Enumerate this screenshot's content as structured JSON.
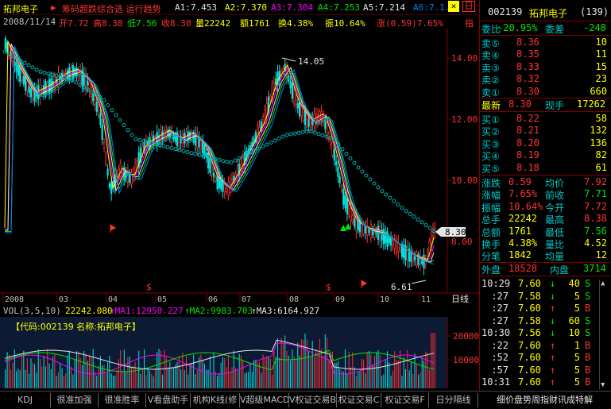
{
  "header": {
    "stock_name": "拓邦电子",
    "indicator_title": "筹码超跌综合选 运行趋势",
    "a1": "A1:7.453",
    "a2": "A2:7.370",
    "a3": "A3:7.304",
    "a4": "A4:7.253",
    "a5": "A5:7.214",
    "a6": "A6:7.1..",
    "window_close": "日"
  },
  "price_line": {
    "date": "2008/11/14",
    "open": "开7.72",
    "high": "高8.38",
    "low": "低7.56",
    "close": "收8.30",
    "volume": "量22242",
    "amount": "额1761",
    "turnover": "换4.38%",
    "amplitude": "振10.64%",
    "change": "涨(0.59)7.65%",
    "extra": "指"
  },
  "price_axis": [
    "14.00",
    "12.00",
    "10.00",
    "8.00"
  ],
  "annotations": {
    "high_label": "14.05",
    "low_label": "6.61",
    "current_tag": "8.30"
  },
  "date_axis": [
    "2008",
    "03",
    "04",
    "05",
    "06",
    "07",
    "08",
    "09",
    "10",
    "11"
  ],
  "date_axis_right": "日线",
  "volume_header": {
    "title": "VOL(3,5,10)",
    "vol": "22242.080",
    "ma1": "↑MA1:12950.227",
    "ma2": "↑MA2:9983.703",
    "ma3": "↑MA3:6164.927"
  },
  "volume_axis": [
    "20000",
    "10000"
  ],
  "volume_panel_label": "【代码:002139 名称:拓邦电子】",
  "tabs": [
    "KDJ",
    "很准加强",
    "很准胜率",
    "V看盘助手",
    "机构K线(修",
    "V超级MACD",
    "V权证交易B",
    "权证交易C",
    "权证交易F",
    "日分隔线",
    "细价盘势周指财讯成特解"
  ],
  "right_panel": {
    "code": "002139",
    "name": "拓邦电子",
    "count": "(139)",
    "webi_label": "委比",
    "webi_value": "-20.95%",
    "weicha_label": "委差",
    "weicha_value": "-248",
    "asks": [
      {
        "label": "卖⑤",
        "price": "8.36",
        "vol": "10"
      },
      {
        "label": "卖④",
        "price": "8.35",
        "vol": "11"
      },
      {
        "label": "卖③",
        "price": "8.33",
        "vol": "15"
      },
      {
        "label": "卖②",
        "price": "8.32",
        "vol": "23"
      },
      {
        "label": "卖①",
        "price": "8.30",
        "vol": "660"
      }
    ],
    "latest_label": "最新",
    "latest_price": "8.30",
    "xianshou_label": "现手",
    "xianshou_value": "17262",
    "bids": [
      {
        "label": "买①",
        "price": "8.22",
        "vol": "58"
      },
      {
        "label": "买②",
        "price": "8.21",
        "vol": "132"
      },
      {
        "label": "买③",
        "price": "8.20",
        "vol": "136"
      },
      {
        "label": "买④",
        "price": "8.19",
        "vol": "82"
      },
      {
        "label": "买⑤",
        "price": "8.18",
        "vol": "61"
      }
    ],
    "stats": [
      {
        "l1": "涨跌",
        "v1": "0.59",
        "l2": "均价",
        "v2": "7.92"
      },
      {
        "l1": "涨幅",
        "v1": "7.65%",
        "l2": "前收",
        "v2": "7.71"
      },
      {
        "l1": "振幅",
        "v1": "10.64%",
        "l2": "今开",
        "v2": "7.72"
      },
      {
        "l1": "总手",
        "v1": "22242",
        "l2": "最高",
        "v2": "8.38"
      },
      {
        "l1": "总额",
        "v1": "1761",
        "l2": "最低",
        "v2": "7.56"
      },
      {
        "l1": "换手",
        "v1": "4.38%",
        "l2": "量比",
        "v2": "4.52"
      },
      {
        "l1": "分笔",
        "v1": "1842",
        "l2": "均量",
        "v2": "12"
      }
    ],
    "outer_label": "外盘",
    "outer_value": "18528",
    "inner_label": "内盘",
    "inner_value": "3714",
    "ticks": [
      {
        "time": "10:29",
        "price": "7.60",
        "arrow": "↓",
        "vol": "40",
        "bs": "S"
      },
      {
        "time": ":27",
        "price": "7.58",
        "arrow": "↓",
        "vol": "5",
        "bs": "S"
      },
      {
        "time": ":27",
        "price": "7.60",
        "arrow": "↑",
        "vol": "5",
        "bs": "B"
      },
      {
        "time": ":27",
        "price": "7.58",
        "arrow": "↓",
        "vol": "60",
        "bs": "S"
      },
      {
        "time": "10:30",
        "price": "7.56",
        "arrow": "↓",
        "vol": "10",
        "bs": "S"
      },
      {
        "time": ":22",
        "price": "7.60",
        "arrow": "↑",
        "vol": "1",
        "bs": "B"
      },
      {
        "time": ":52",
        "price": "7.60",
        "arrow": "↑",
        "vol": "5",
        "bs": "B"
      },
      {
        "time": ":57",
        "price": "7.60",
        "arrow": "↑",
        "vol": "5",
        "bs": "B"
      },
      {
        "time": "10:31",
        "price": "7.60",
        "arrow": "↑",
        "vol": "5",
        "bs": "B"
      }
    ]
  },
  "colors": {
    "up": "#ff3232",
    "down": "#00e6e6",
    "ma_orbit": "#00b0b0",
    "axis_red": "#800000"
  }
}
